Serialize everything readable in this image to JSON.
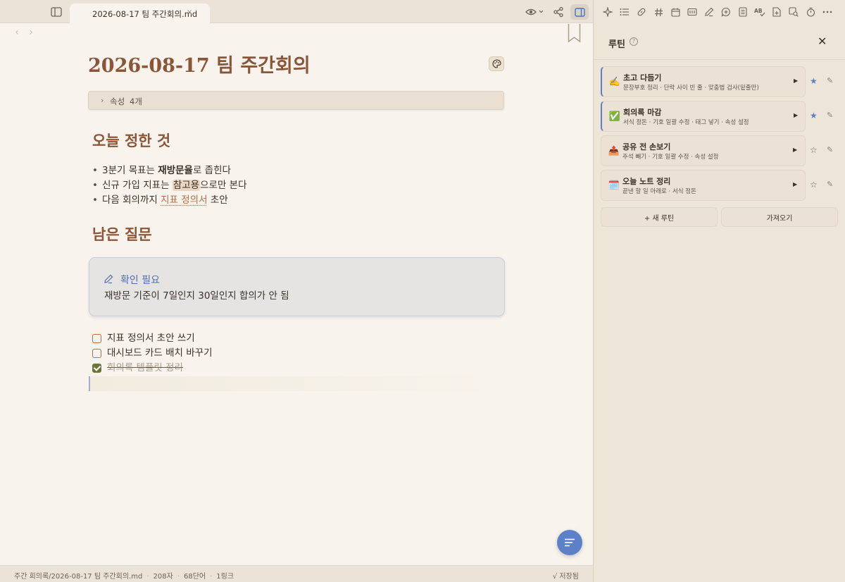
{
  "tab": {
    "title": "2026-08-17 팀 주간회의.md",
    "close": "×"
  },
  "document": {
    "title": "2026-08-17 팀 주간회의",
    "properties": {
      "label": "속성",
      "count": "4개"
    },
    "section1": {
      "heading": "오늘 정한 것",
      "bullets": [
        {
          "pre": "3분기 목표는 ",
          "bold": "재방문율",
          "post": "로 좁힌다"
        },
        {
          "pre": "신규 가입 지표는 ",
          "highlight": "참고용",
          "post": "으로만 본다"
        },
        {
          "pre": "다음 회의까지 ",
          "link": "지표 정의서",
          "post": " 초안"
        }
      ]
    },
    "section2": {
      "heading": "남은 질문"
    },
    "callout": {
      "title": "확인 필요",
      "body": "재방문 기준이 7일인지 30일인지 합의가 안 됨"
    },
    "tasks": [
      {
        "text": "지표 정의서 초안 쓰기",
        "done": false
      },
      {
        "text": "대시보드 카드 배치 바꾸기",
        "done": false
      },
      {
        "text": "회의록 템플릿 정리",
        "done": true
      }
    ]
  },
  "statusbar": {
    "path": "주간 회의록/2026-08-17 팀 주간회의.md",
    "chars": "208자",
    "words": "68단어",
    "links": "1링크",
    "saved": "√ 저장됨"
  },
  "panel": {
    "title": "루틴",
    "help": "?",
    "close": "✕",
    "routines": [
      {
        "emoji": "✍️",
        "name": "초고 다듬기",
        "desc": "문장부호 정리 · 단락 사이 빈 줄 · 맞춤법 검사(밑줄만)",
        "starred": true,
        "active": true
      },
      {
        "emoji": "✅",
        "name": "회의록 마감",
        "desc": "서식 정돈 · 기호 일괄 수정 · 태그 넣기 · 속성 설정",
        "starred": true,
        "active": true
      },
      {
        "emoji": "📤",
        "name": "공유 전 손보기",
        "desc": "주석 빼기 · 기호 일괄 수정 · 속성 설정",
        "starred": false,
        "active": false
      },
      {
        "emoji": "🗓️",
        "name": "오늘 노트 정리",
        "desc": "끝낸 할 일 아래로 · 서식 정돈",
        "starred": false,
        "active": false
      }
    ],
    "new_routine": "+ 새 루틴",
    "import": "가져오기"
  },
  "colors": {
    "accent": "#5d81c9",
    "heading": "#8b5637",
    "link": "#b36f45",
    "task_done": "#6b7636"
  }
}
